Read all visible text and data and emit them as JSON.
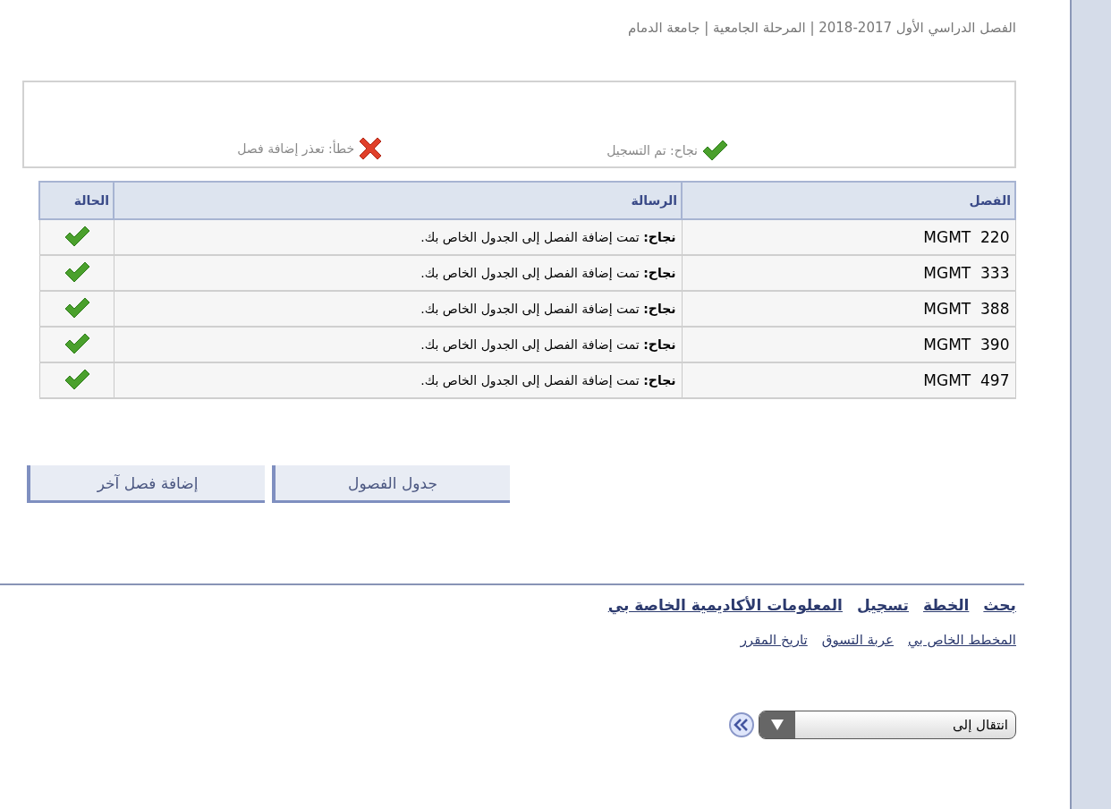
{
  "header": {
    "term": "الفصل الدراسي الأول 2017-2018 | المرحلة الجامعية | جامعة الدمام"
  },
  "legend": [
    {
      "kind": "success",
      "label": "نجاح: تم التسجيل"
    },
    {
      "kind": "error",
      "label": "خطأ: تعذر إضافة فصل"
    }
  ],
  "table": {
    "columns": [
      "الفصل",
      "الرسالة",
      "الحالة"
    ],
    "rows": [
      {
        "course": "MGMT  220",
        "message": "**نجاح:** تمت إضافة الفصل إلى الجدول الخاص بك.",
        "kind": "success"
      },
      {
        "course": "MGMT  333",
        "message": "**نجاح:** تمت إضافة الفصل إلى الجدول الخاص بك.",
        "kind": "success"
      },
      {
        "course": "MGMT  388",
        "message": "**نجاح:** تمت إضافة الفصل إلى الجدول الخاص بك.",
        "kind": "success"
      },
      {
        "course": "MGMT  390",
        "message": "**نجاح:** تمت إضافة الفصل إلى الجدول الخاص بك.",
        "kind": "success"
      },
      {
        "course": "MGMT  497",
        "message": "**نجاح:** تمت إضافة الفصل إلى الجدول الخاص بك.",
        "kind": "success"
      }
    ]
  },
  "buttons": [
    "جدول الفصول",
    "إضافة فصل آخر"
  ],
  "nav_links": [
    {
      "label": "بحث",
      "bold": true
    },
    {
      "label": "الخطة",
      "bold": true
    },
    {
      "label": "تسجيل",
      "bold": true
    },
    {
      "label": "المعلومات الأكاديمية الخاصة بي",
      "bold": true
    },
    {
      "label": "المخطط الخاص بي",
      "bold": false
    },
    {
      "label": "عربة التسوق",
      "bold": false
    },
    {
      "label": "تاريخ المقرر",
      "bold": false
    }
  ],
  "jump": {
    "value": "انتقال إلى"
  }
}
